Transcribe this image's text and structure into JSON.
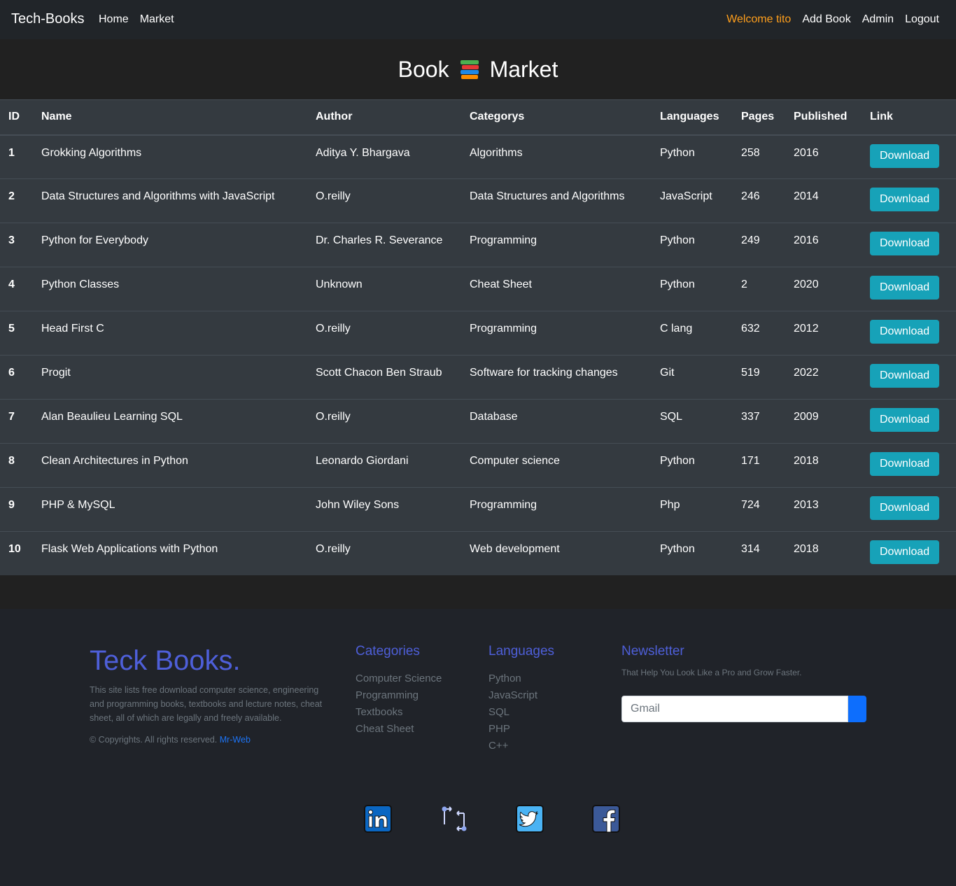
{
  "navbar": {
    "brand": "Tech-Books",
    "links_left": [
      "Home",
      "Market"
    ],
    "welcome": "Welcome tito",
    "links_right": [
      "Add Book",
      "Admin",
      "Logout"
    ]
  },
  "page": {
    "title_left": "Book",
    "title_right": "Market"
  },
  "table": {
    "headers": [
      "ID",
      "Name",
      "Author",
      "Categorys",
      "Languages",
      "Pages",
      "Published",
      "Link"
    ],
    "button_label": "Download",
    "rows": [
      {
        "id": "1",
        "name": "Grokking Algorithms",
        "author": "Aditya Y. Bhargava",
        "category": "Algorithms",
        "language": "Python",
        "pages": "258",
        "published": "2016"
      },
      {
        "id": "2",
        "name": "Data Structures and Algorithms with JavaScript",
        "author": "O.reilly",
        "category": "Data Structures and Algorithms",
        "language": "JavaScript",
        "pages": "246",
        "published": "2014"
      },
      {
        "id": "3",
        "name": "Python for Everybody",
        "author": "Dr. Charles R. Severance",
        "category": "Programming",
        "language": "Python",
        "pages": "249",
        "published": "2016"
      },
      {
        "id": "4",
        "name": "Python Classes",
        "author": "Unknown",
        "category": "Cheat Sheet",
        "language": "Python",
        "pages": "2",
        "published": "2020"
      },
      {
        "id": "5",
        "name": "Head First C",
        "author": "O.reilly",
        "category": "Programming",
        "language": "C lang",
        "pages": "632",
        "published": "2012"
      },
      {
        "id": "6",
        "name": "Progit",
        "author": "Scott Chacon Ben Straub",
        "category": "Software for tracking changes",
        "language": "Git",
        "pages": "519",
        "published": "2022"
      },
      {
        "id": "7",
        "name": "Alan Beaulieu Learning SQL",
        "author": "O.reilly",
        "category": "Database",
        "language": "SQL",
        "pages": "337",
        "published": "2009"
      },
      {
        "id": "8",
        "name": "Clean Architectures in Python",
        "author": "Leonardo Giordani",
        "category": "Computer science",
        "language": "Python",
        "pages": "171",
        "published": "2018"
      },
      {
        "id": "9",
        "name": "PHP & MySQL",
        "author": "John Wiley Sons",
        "category": "Programming",
        "language": "Php",
        "pages": "724",
        "published": "2013"
      },
      {
        "id": "10",
        "name": "Flask Web Applications with Python",
        "author": "O.reilly",
        "category": "Web development",
        "language": "Python",
        "pages": "314",
        "published": "2018"
      }
    ]
  },
  "footer": {
    "brand": "Teck Books.",
    "description": "This site lists free download computer science, engineering and programming books, textbooks and lecture notes, cheat sheet, all of which are legally and freely available.",
    "copyright": "© Copyrights. All rights reserved.",
    "author_link": "Mr-Web",
    "categories_title": "Categories",
    "categories": [
      "Computer Science",
      "Programming",
      "Textbooks",
      "Cheat Sheet"
    ],
    "languages_title": "Languages",
    "languages": [
      "Python",
      "JavaScript",
      "SQL",
      "PHP",
      "C++"
    ],
    "newsletter_title": "Newsletter",
    "newsletter_text": "That Help You Look Like a Pro and Grow Faster.",
    "newsletter_placeholder": "Gmail",
    "socials": [
      "linkedin-icon",
      "share-icon",
      "twitter-icon",
      "facebook-icon"
    ]
  },
  "colors": {
    "accent_button": "#17a2b8",
    "welcome": "#ff9f1c",
    "footer_heading": "#4e5fd9",
    "link": "#1d74f5"
  }
}
